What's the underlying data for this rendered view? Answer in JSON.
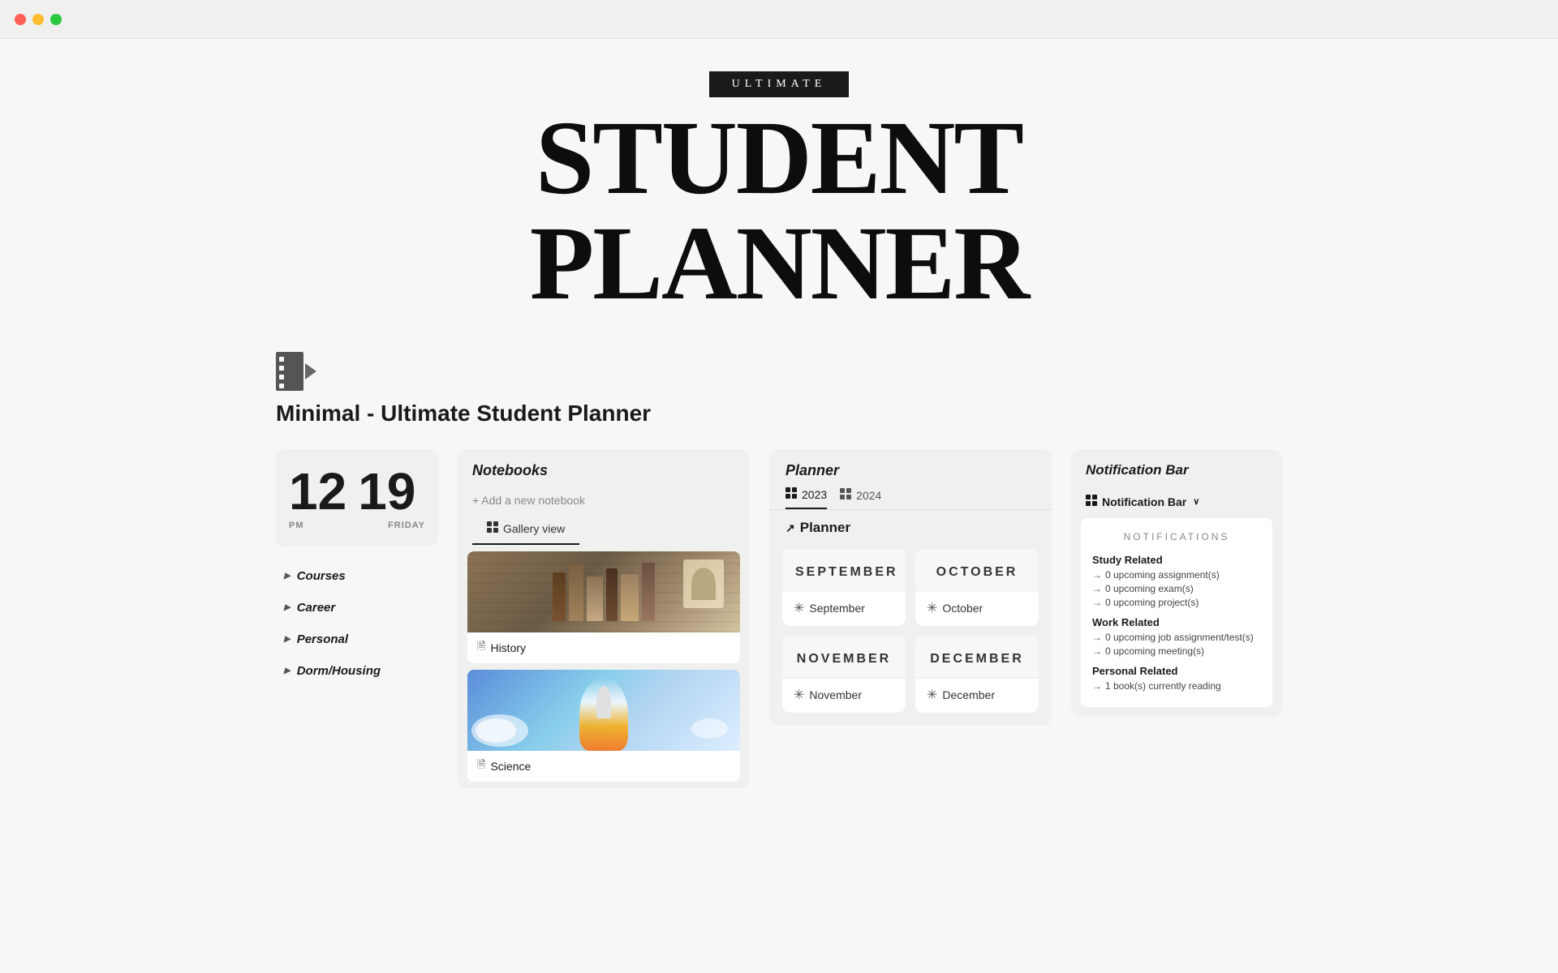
{
  "window": {
    "traffic": [
      "red",
      "yellow",
      "green"
    ]
  },
  "header": {
    "badge": "ULTIMATE",
    "title": "STUDENT PLANNER"
  },
  "subtitle": "Minimal - Ultimate Student Planner",
  "clock": {
    "hour": "12",
    "minute": "19",
    "period": "PM",
    "day": "FRIDAY"
  },
  "nav": {
    "items": [
      {
        "label": "Courses"
      },
      {
        "label": "Career"
      },
      {
        "label": "Personal"
      },
      {
        "label": "Dorm/Housing"
      }
    ]
  },
  "notebooks": {
    "title": "Notebooks",
    "add_label": "+ Add a new notebook",
    "gallery_label": "Gallery view",
    "items": [
      {
        "name": "History",
        "icon": "🗎"
      },
      {
        "name": "Science",
        "icon": "🗎"
      }
    ]
  },
  "planner": {
    "title": "Planner",
    "section_label": "Planner",
    "tabs": [
      {
        "label": "2023",
        "active": true
      },
      {
        "label": "2024",
        "active": false
      }
    ],
    "months": [
      {
        "name": "SEPTEMBER",
        "label": "September"
      },
      {
        "name": "OCTOBER",
        "label": "October"
      },
      {
        "name": "NOVEMBER",
        "label": "November"
      },
      {
        "name": "DECEMBER",
        "label": "December"
      }
    ]
  },
  "notifications": {
    "panel_title": "Notification Bar",
    "bar_label": "Notification Bar",
    "section_title": "NOTIFICATIONS",
    "sections": [
      {
        "title": "Study Related",
        "items": [
          "→0 upcoming assignment(s)",
          "→0 upcoming exam(s)",
          "→0 upcoming project(s)"
        ]
      },
      {
        "title": "Work Related",
        "items": [
          "→0 upcoming job assignment/test(s)",
          "→0 upcoming meeting(s)"
        ]
      },
      {
        "title": "Personal Related",
        "items": [
          "→1 book(s) currently reading"
        ]
      }
    ]
  }
}
